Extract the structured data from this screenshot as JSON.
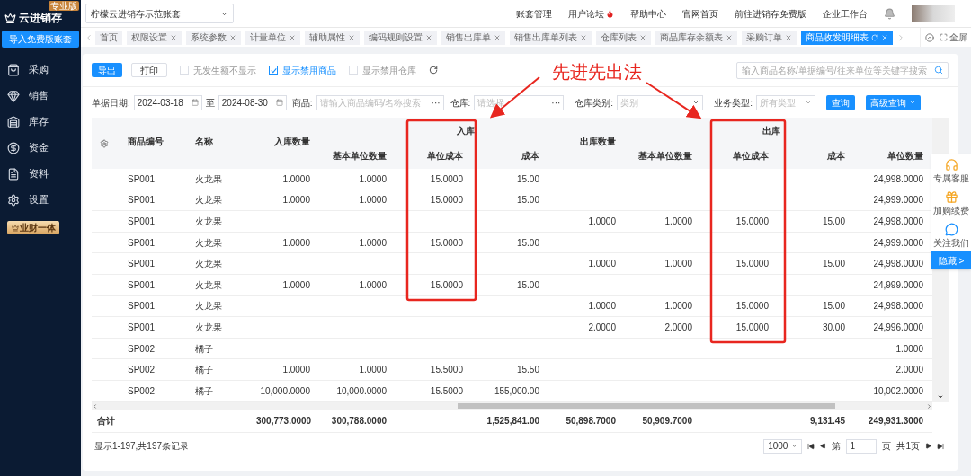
{
  "sidebar": {
    "logo": "云进销存",
    "edition": "专业版",
    "import_button": "导入免费版账套",
    "items": [
      {
        "kind": "bag",
        "label": "采购"
      },
      {
        "kind": "sale",
        "label": "销售"
      },
      {
        "kind": "stock",
        "label": "库存"
      },
      {
        "kind": "money",
        "label": "资金"
      },
      {
        "kind": "doc",
        "label": "资料"
      },
      {
        "kind": "gear",
        "label": "设置"
      }
    ],
    "promo": "业财一体"
  },
  "topbar": {
    "account": "柠檬云进销存示范账套",
    "links": [
      {
        "label": "账套管理",
        "hot": false
      },
      {
        "label": "用户论坛",
        "hot": true
      },
      {
        "label": "帮助中心",
        "hot": false
      },
      {
        "label": "官网首页",
        "hot": false
      },
      {
        "label": "前往进销存免费版",
        "hot": false
      },
      {
        "label": "企业工作台",
        "hot": false
      }
    ]
  },
  "tabs": [
    {
      "label": "首页",
      "selected": false,
      "closable": false
    },
    {
      "label": "权限设置",
      "selected": false,
      "closable": true
    },
    {
      "label": "系统参数",
      "selected": false,
      "closable": true
    },
    {
      "label": "计量单位",
      "selected": false,
      "closable": true
    },
    {
      "label": "辅助属性",
      "selected": false,
      "closable": true
    },
    {
      "label": "编码规则设置",
      "selected": false,
      "closable": true
    },
    {
      "label": "销售出库单",
      "selected": false,
      "closable": true
    },
    {
      "label": "销售出库单列表",
      "selected": false,
      "closable": true
    },
    {
      "label": "仓库列表",
      "selected": false,
      "closable": true
    },
    {
      "label": "商品库存余额表",
      "selected": false,
      "closable": true
    },
    {
      "label": "采购订单",
      "selected": false,
      "closable": true
    },
    {
      "label": "商品收发明细表",
      "selected": true,
      "closable": true
    }
  ],
  "fullscreen": "全屏",
  "toolbar": {
    "export": "导出",
    "print": "打印",
    "options": [
      {
        "label": "无发生额不显示",
        "checked": false
      },
      {
        "label": "显示禁用商品",
        "checked": true
      },
      {
        "label": "显示禁用仓库",
        "checked": false
      }
    ],
    "search_placeholder": "输入商品名称/单据编号/往来单位等关键字搜索"
  },
  "filters": {
    "date_label": "单据日期:",
    "date_from": "2024-03-18",
    "date_to_label": "至",
    "date_to": "2024-08-30",
    "goods_label": "商品:",
    "goods_placeholder": "请输入商品编码/名称搜索",
    "goods_more": "···",
    "warehouse_label": "仓库:",
    "warehouse_placeholder": "请选择",
    "warehouse_more": "···",
    "wh_type_label": "仓库类别:",
    "wh_type_placeholder": "类别",
    "biz_type_label": "业务类型:",
    "biz_type_placeholder": "所有类型",
    "query": "查询",
    "advanced": "高级查询"
  },
  "table": {
    "in_group": "入库",
    "out_group": "出库",
    "columns": [
      "商品编号",
      "名称",
      "入库数量",
      "基本单位数量",
      "单位成本",
      "成本",
      "出库数量",
      "基本单位数量",
      "单位成本",
      "成本",
      "单位数量"
    ],
    "rows": [
      [
        "SP001",
        "火龙果",
        "1.0000",
        "1.0000",
        "15.0000",
        "15.00",
        null,
        null,
        null,
        null,
        "24,998.0000"
      ],
      [
        "SP001",
        "火龙果",
        "1.0000",
        "1.0000",
        "15.0000",
        "15.00",
        null,
        null,
        null,
        null,
        "24,999.0000"
      ],
      [
        "SP001",
        "火龙果",
        null,
        null,
        null,
        null,
        "1.0000",
        "1.0000",
        "15.0000",
        "15.00",
        "24,998.0000"
      ],
      [
        "SP001",
        "火龙果",
        "1.0000",
        "1.0000",
        "15.0000",
        "15.00",
        null,
        null,
        null,
        null,
        "24,999.0000"
      ],
      [
        "SP001",
        "火龙果",
        null,
        null,
        null,
        null,
        "1.0000",
        "1.0000",
        "15.0000",
        "15.00",
        "24,998.0000"
      ],
      [
        "SP001",
        "火龙果",
        "1.0000",
        "1.0000",
        "15.0000",
        "15.00",
        null,
        null,
        null,
        null,
        "24,999.0000"
      ],
      [
        "SP001",
        "火龙果",
        null,
        null,
        null,
        null,
        "1.0000",
        "1.0000",
        "15.0000",
        "15.00",
        "24,998.0000"
      ],
      [
        "SP001",
        "火龙果",
        null,
        null,
        null,
        null,
        "2.0000",
        "2.0000",
        "15.0000",
        "30.00",
        "24,996.0000"
      ],
      [
        "SP002",
        "橘子",
        null,
        null,
        null,
        null,
        null,
        null,
        null,
        null,
        "1.0000"
      ],
      [
        "SP002",
        "橘子",
        "1.0000",
        "1.0000",
        "15.5000",
        "15.50",
        null,
        null,
        null,
        null,
        "2.0000"
      ],
      [
        "SP002",
        "橘子",
        "10,000.0000",
        "10,000.0000",
        "15.5000",
        "155,000.00",
        null,
        null,
        null,
        null,
        "10,002.0000"
      ]
    ],
    "total": {
      "label": "合计",
      "cells": [
        null,
        "300,773.0000",
        "300,788.0000",
        null,
        "1,525,841.00",
        "50,898.7000",
        "50,909.7000",
        null,
        "9,131.45",
        "249,931.3000"
      ]
    }
  },
  "footer": {
    "summary": "显示1-197,共197条记录",
    "page_size": "1000",
    "page_label": "第",
    "page": "1",
    "page_unit": "页",
    "page_total": "共1页"
  },
  "float_panel": [
    {
      "kind": "service",
      "label": "专属客服"
    },
    {
      "kind": "renew",
      "label": "加购续费"
    },
    {
      "kind": "follow",
      "label": "关注我们"
    }
  ],
  "hide_button": "隐藏 >",
  "annotation": {
    "text": "先进先出法"
  }
}
